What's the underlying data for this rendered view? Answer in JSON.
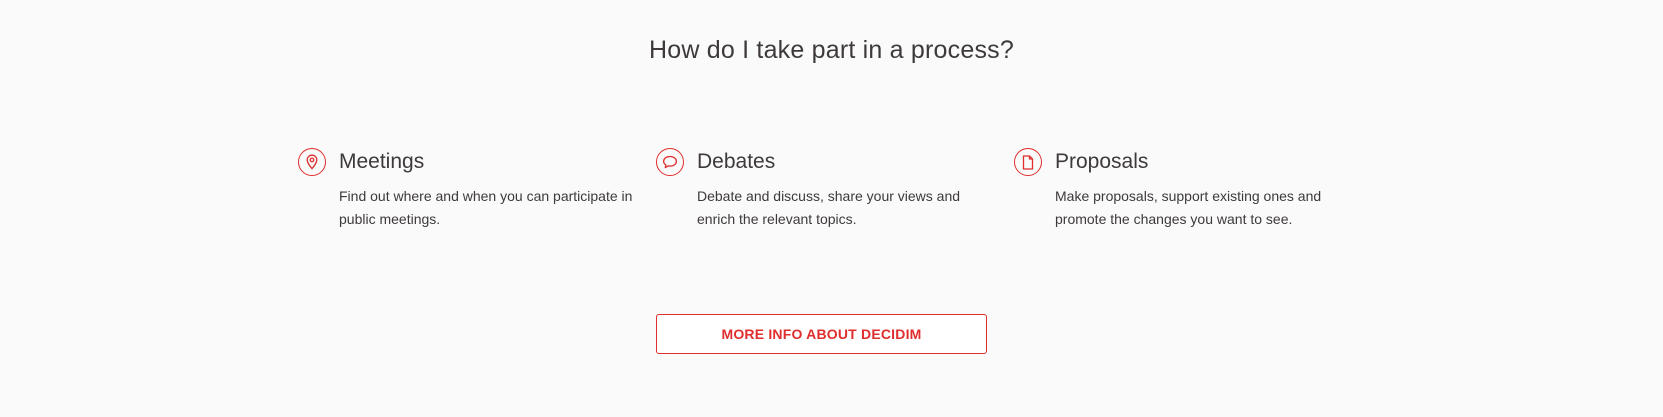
{
  "section": {
    "title": "How do I take part in a process?"
  },
  "cards": [
    {
      "icon": "map-pin-icon",
      "title": "Meetings",
      "description": "Find out where and when you can participate in public meetings."
    },
    {
      "icon": "speech-bubble-icon",
      "title": "Debates",
      "description": "Debate and discuss, share your views and enrich the relevant topics."
    },
    {
      "icon": "document-icon",
      "title": "Proposals",
      "description": "Make proposals, support existing ones and promote the changes you want to see."
    }
  ],
  "cta": {
    "label": "MORE INFO ABOUT DECIDIM"
  },
  "colors": {
    "accent": "#e02d2d",
    "text": "#3d393c",
    "background": "#fafafa"
  }
}
